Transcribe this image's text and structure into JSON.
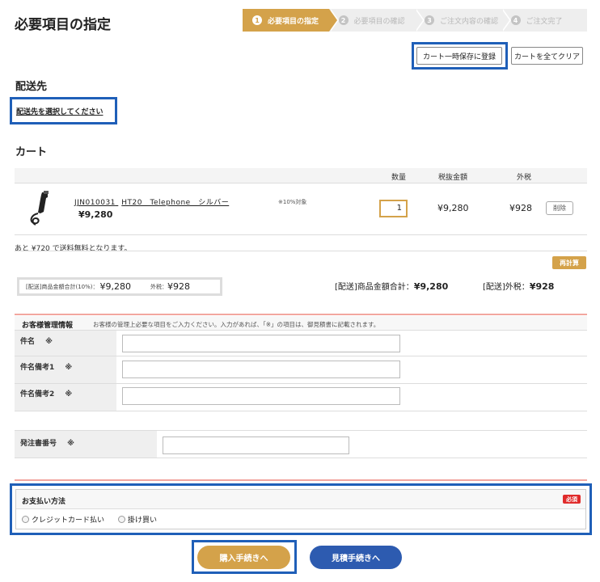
{
  "page": {
    "title": "必要項目の指定"
  },
  "steps": [
    {
      "num": "1",
      "label": "必要項目の指定"
    },
    {
      "num": "2",
      "label": "必要項目の確認"
    },
    {
      "num": "3",
      "label": "ご注文内容の確認"
    },
    {
      "num": "4",
      "label": "ご注文完了"
    }
  ],
  "toolbar": {
    "save_cart": "カート一時保存に登録",
    "clear_cart": "カートを全てクリア"
  },
  "delivery": {
    "heading": "配送先",
    "select_link": "配送先を選択してください"
  },
  "cart": {
    "heading": "カート",
    "columns": {
      "qty": "数量",
      "price": "税抜金額",
      "tax": "外税"
    },
    "item": {
      "code": "JJN010031",
      "name": "HT20　Telephone　シルバー",
      "tax_note": "※10%対象",
      "unit_price": "¥9,280",
      "qty": "1",
      "price": "¥9,280",
      "tax": "¥928",
      "delete": "削除"
    },
    "free_shipping_note": "あと ¥720 で送料無料となります。",
    "recalc": "再計算",
    "summary_box": {
      "label": "[配送]商品金額合計(10%)：",
      "amount": "¥9,280",
      "tax_label": "外税：",
      "tax": "¥928"
    },
    "total_label": "[配送]商品金額合計：",
    "total": "¥9,280",
    "total_tax_label": "[配送]外税：",
    "total_tax": "¥928"
  },
  "customer": {
    "heading": "お客様管理情報",
    "description": "お客様の管理上必要な項目をご入力ください。入力があれば、「※」の項目は、御見積書に記載されます。",
    "fields": [
      {
        "label": "件名",
        "mark": "※"
      },
      {
        "label": "件名備考1",
        "mark": "※"
      },
      {
        "label": "件名備考2",
        "mark": "※"
      }
    ],
    "po": {
      "label": "発注書番号",
      "mark": "※"
    }
  },
  "payment": {
    "heading": "お支払い方法",
    "required": "必須",
    "options": [
      "クレジットカード払い",
      "掛け買い"
    ]
  },
  "actions": {
    "purchase": "購入手続きへ",
    "quote": "見積手続きへ"
  },
  "colors": {
    "accent": "#d4a24a",
    "highlight": "#1f5fb8",
    "quote_button": "#2d5bb0",
    "required": "#e02b2b"
  }
}
